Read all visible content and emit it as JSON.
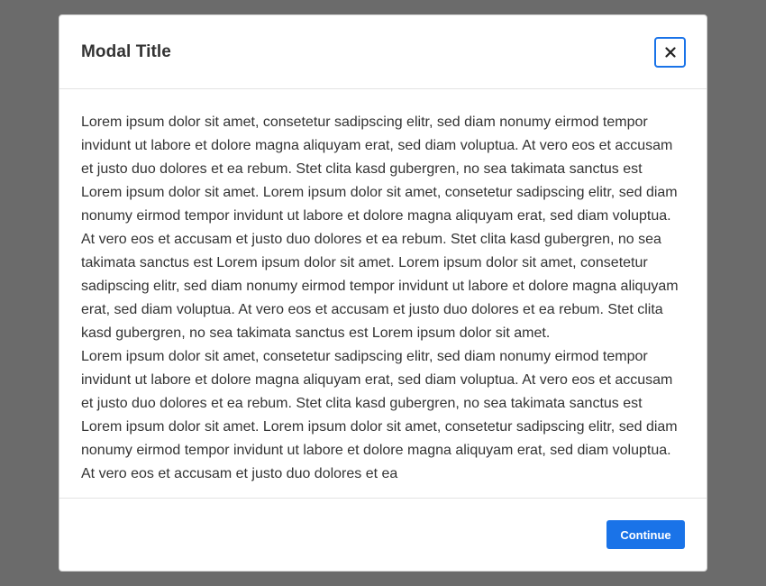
{
  "modal": {
    "title": "Modal Title",
    "close_icon": "close-icon",
    "paragraphs": [
      "Lorem ipsum dolor sit amet, consetetur sadipscing elitr, sed diam nonumy eirmod tempor invidunt ut labore et dolore magna aliquyam erat, sed diam voluptua. At vero eos et accusam et justo duo dolores et ea rebum. Stet clita kasd gubergren, no sea takimata sanctus est Lorem ipsum dolor sit amet. Lorem ipsum dolor sit amet, consetetur sadipscing elitr, sed diam nonumy eirmod tempor invidunt ut labore et dolore magna aliquyam erat, sed diam voluptua. At vero eos et accusam et justo duo dolores et ea rebum. Stet clita kasd gubergren, no sea takimata sanctus est Lorem ipsum dolor sit amet. Lorem ipsum dolor sit amet, consetetur sadipscing elitr, sed diam nonumy eirmod tempor invidunt ut labore et dolore magna aliquyam erat, sed diam voluptua. At vero eos et accusam et justo duo dolores et ea rebum. Stet clita kasd gubergren, no sea takimata sanctus est Lorem ipsum dolor sit amet.",
      "Lorem ipsum dolor sit amet, consetetur sadipscing elitr, sed diam nonumy eirmod tempor invidunt ut labore et dolore magna aliquyam erat, sed diam voluptua. At vero eos et accusam et justo duo dolores et ea rebum. Stet clita kasd gubergren, no sea takimata sanctus est Lorem ipsum dolor sit amet. Lorem ipsum dolor sit amet, consetetur sadipscing elitr, sed diam nonumy eirmod tempor invidunt ut labore et dolore magna aliquyam erat, sed diam voluptua. At vero eos et accusam et justo duo dolores et ea"
    ],
    "continue_label": "Continue"
  },
  "colors": {
    "backdrop": "#6b6b6b",
    "accent": "#1a73e8",
    "text": "#333333"
  }
}
